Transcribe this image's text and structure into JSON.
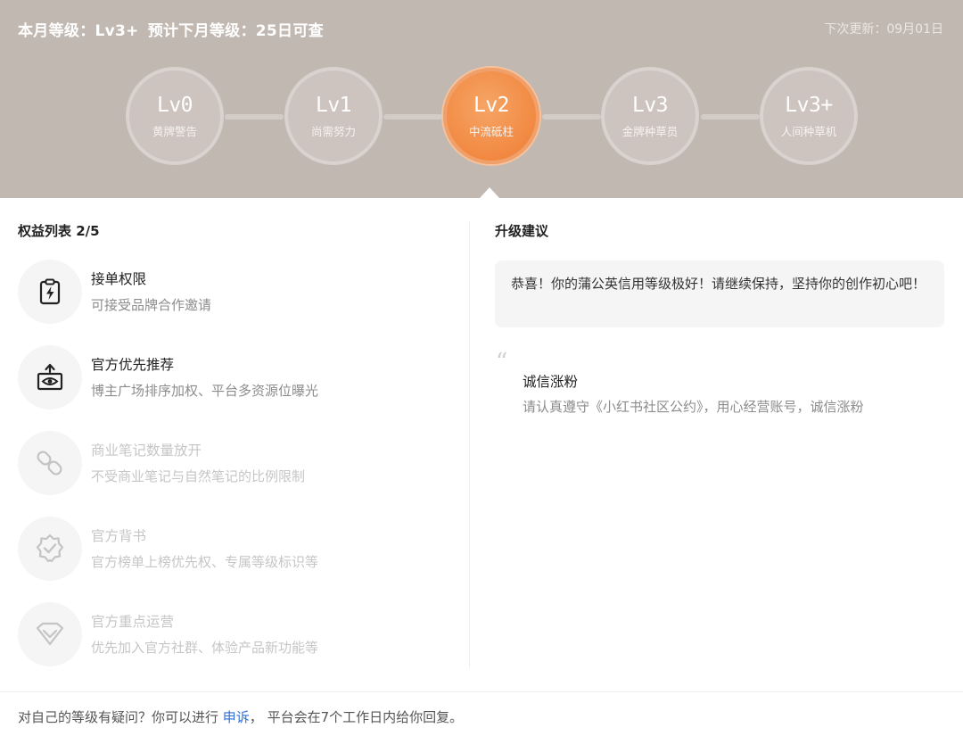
{
  "header": {
    "current_label": "本月等级：",
    "current_value": "Lv3+",
    "forecast_label": "预计下月等级：",
    "forecast_value": "25日可查",
    "next_update": "下次更新：09月01日"
  },
  "levels": [
    {
      "name": "Lv0",
      "title": "黄牌警告"
    },
    {
      "name": "Lv1",
      "title": "尚需努力"
    },
    {
      "name": "Lv2",
      "title": "中流砥柱"
    },
    {
      "name": "Lv3",
      "title": "金牌种草员"
    },
    {
      "name": "Lv3+",
      "title": "人间种草机"
    }
  ],
  "active_level_index": 2,
  "benefits_title": "权益列表 2/5",
  "benefits": [
    {
      "name": "接单权限",
      "desc": "可接受品牌合作邀请",
      "enabled": true,
      "icon": "clipboard-bolt-icon"
    },
    {
      "name": "官方优先推荐",
      "desc": "博主广场排序加权、平台多资源位曝光",
      "enabled": true,
      "icon": "eye-upload-icon"
    },
    {
      "name": "商业笔记数量放开",
      "desc": "不受商业笔记与自然笔记的比例限制",
      "enabled": false,
      "icon": "link-icon"
    },
    {
      "name": "官方背书",
      "desc": "官方榜单上榜优先权、专属等级标识等",
      "enabled": false,
      "icon": "verified-badge-icon"
    },
    {
      "name": "官方重点运营",
      "desc": "优先加入官方社群、体验产品新功能等",
      "enabled": false,
      "icon": "diamond-icon"
    }
  ],
  "suggestion": {
    "title": "升级建议",
    "tip": "恭喜！你的蒲公英信用等级极好！请继续保持，坚持你的创作初心吧！",
    "quote_mark": "“",
    "item_name": "诚信涨粉",
    "item_desc": "请认真遵守《小红书社区公约》，用心经营账号，诚信涨粉"
  },
  "footer": {
    "prefix": "对自己的等级有疑问？你可以进行 ",
    "link": "申诉",
    "suffix": "， 平台会在7个工作日内给你回复。"
  },
  "colors": {
    "header_bg": "#c2b8b2",
    "active_level": "#f1873f",
    "link": "#2f6fd8"
  }
}
